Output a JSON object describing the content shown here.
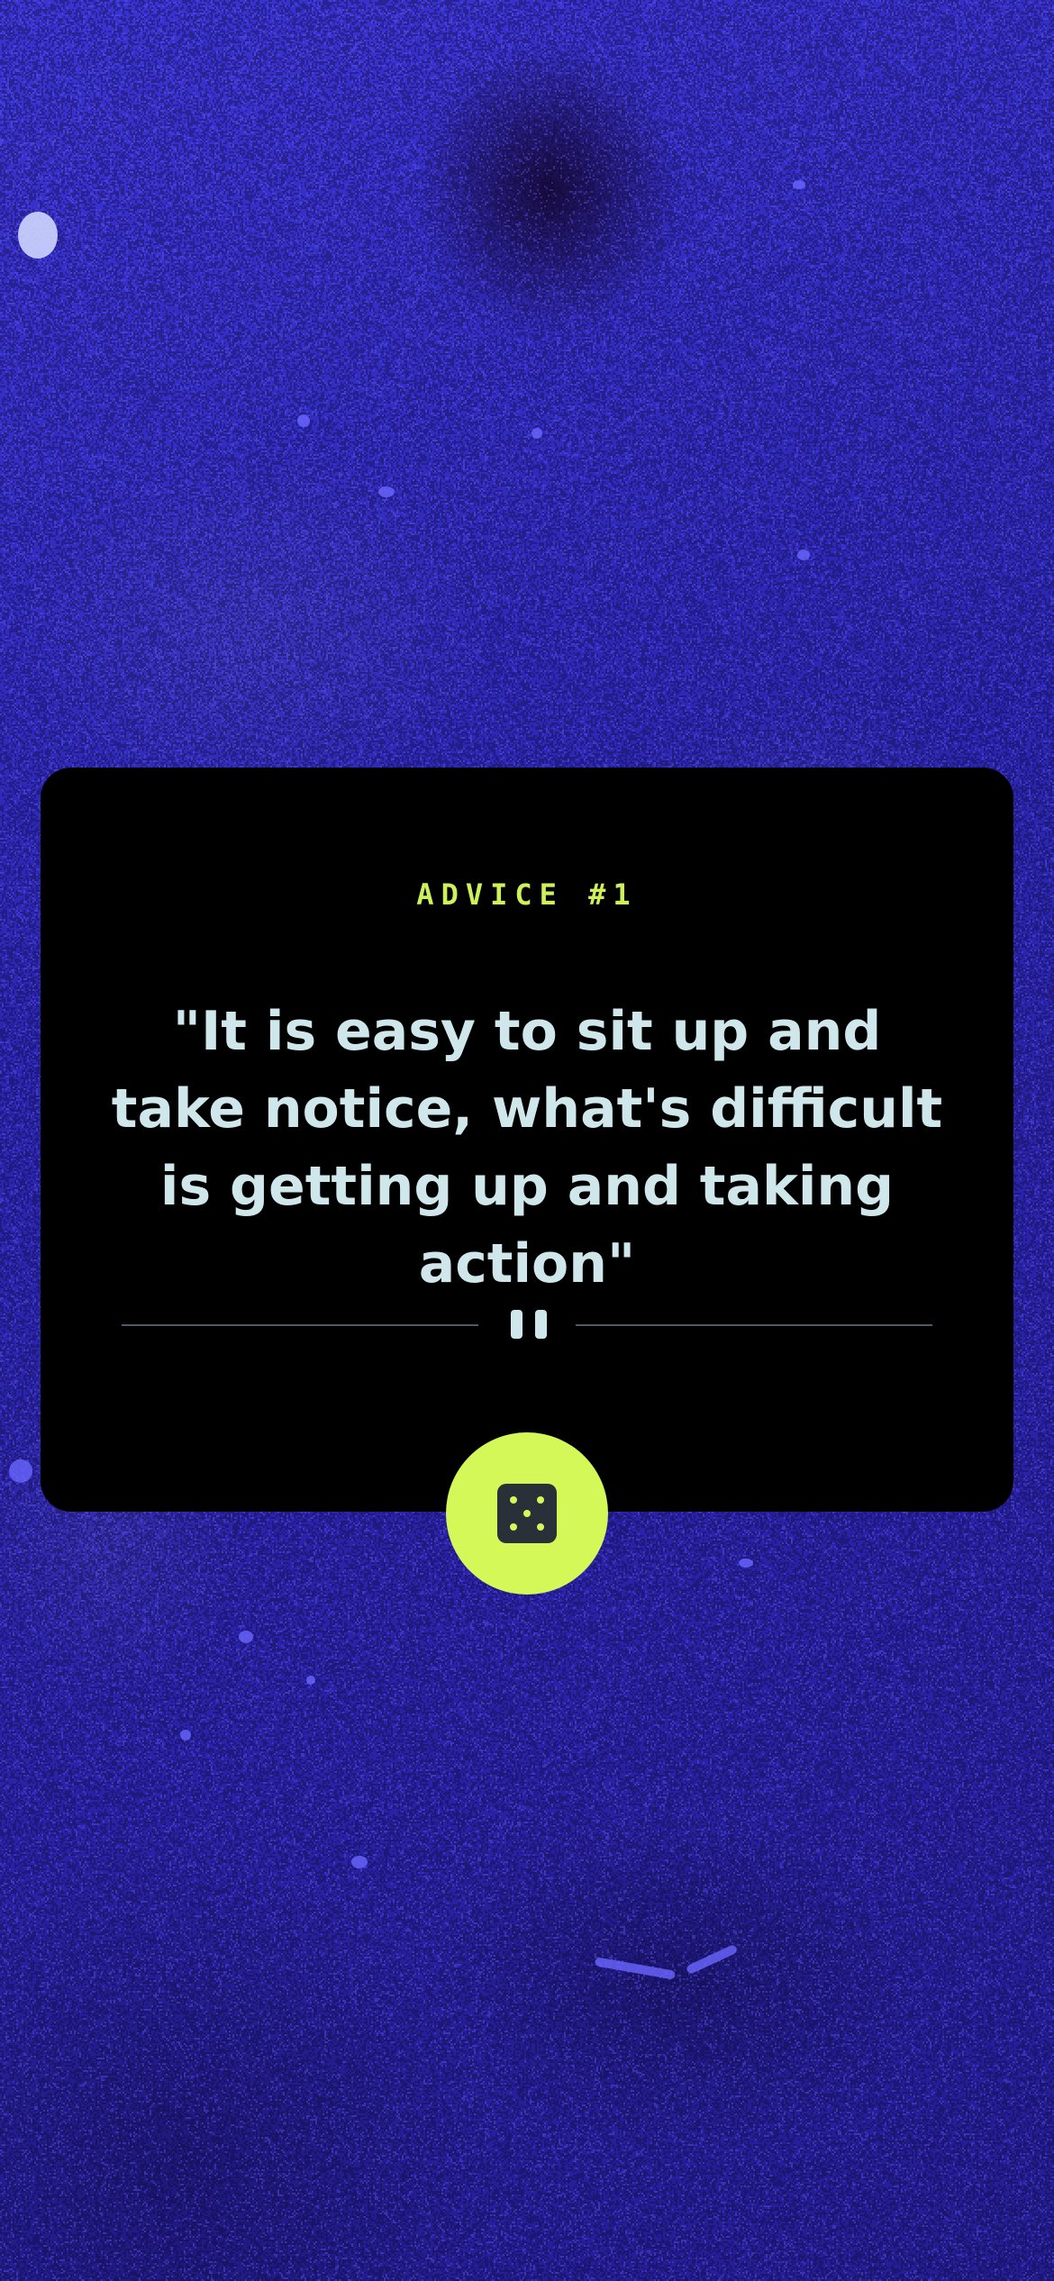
{
  "advice": {
    "heading": "ADVICE #1",
    "quote": "\"It is easy to sit up and take notice, what's difficult is getting up and taking action\""
  },
  "divider": {
    "icon": "pause-icon"
  },
  "dice_button": {
    "icon": "dice-icon"
  },
  "colors": {
    "accent": "#d5f859",
    "card": "#000000",
    "text": "#cfe6ea",
    "background": "#2c26b0",
    "divider": "#4e5a6c"
  }
}
